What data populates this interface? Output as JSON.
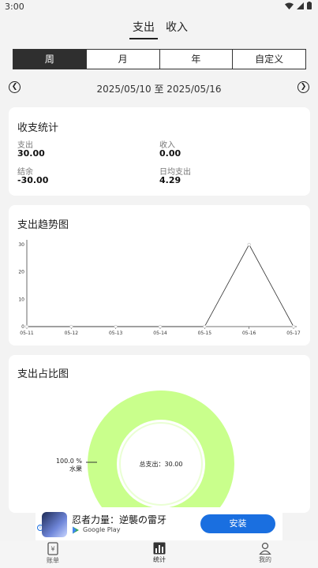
{
  "status": {
    "time": "3:00"
  },
  "type_tabs": [
    {
      "label": "支出"
    },
    {
      "label": "收入"
    }
  ],
  "periods": [
    {
      "label": "周"
    },
    {
      "label": "月"
    },
    {
      "label": "年"
    },
    {
      "label": "自定义"
    }
  ],
  "date_range": "2025/05/10 至 2025/05/16",
  "summary": {
    "title": "收支统计",
    "expense_label": "支出",
    "expense_value": "30.00",
    "income_label": "收入",
    "income_value": "0.00",
    "balance_label": "结余",
    "balance_value": "-30.00",
    "daily_label": "日均支出",
    "daily_value": "4.29"
  },
  "trend": {
    "title": "支出趋势图"
  },
  "proportion": {
    "title": "支出占比图",
    "percent_label": "100.0 %",
    "category_label": "水果",
    "center_label": "总支出：30.00"
  },
  "chart_data": [
    {
      "type": "line",
      "title": "支出趋势图",
      "x": [
        "05-11",
        "05-12",
        "05-13",
        "05-14",
        "05-15",
        "05-16",
        "05-17"
      ],
      "values": [
        0,
        0,
        0,
        0,
        0,
        30,
        0
      ],
      "yticks": [
        "0",
        "10",
        "20",
        "30"
      ],
      "ylim": [
        0,
        30
      ],
      "grid": false
    },
    {
      "type": "pie",
      "title": "支出占比图",
      "labels": [
        "水果"
      ],
      "values": [
        30.0
      ],
      "percent": [
        100.0
      ],
      "color": "#c9ff8c"
    }
  ],
  "ad": {
    "title": "忍者力量：逆襲の雷牙",
    "store": "Google Play",
    "install_label": "安装"
  },
  "bottom_nav": [
    {
      "label": "账单"
    },
    {
      "label": "统计"
    },
    {
      "label": "我的"
    }
  ]
}
